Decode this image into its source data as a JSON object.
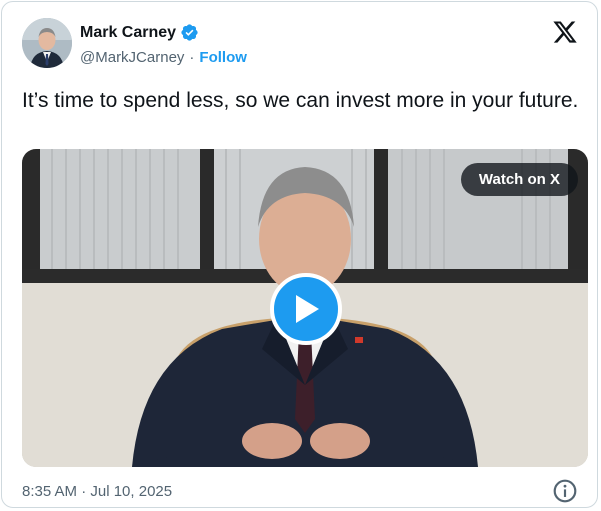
{
  "author": {
    "name": "Mark Carney",
    "handle": "@MarkJCarney",
    "separator": "·",
    "follow_label": "Follow"
  },
  "tweet": {
    "text": "It’s time to spend less, so we can invest more in your future."
  },
  "media": {
    "watch_label": "Watch on X"
  },
  "meta": {
    "timestamp": "8:35 AM · Jul 10, 2025"
  },
  "colors": {
    "accent": "#1d9bf0",
    "text": "#0f1419",
    "secondary": "#536471"
  },
  "icons": [
    "verified-badge-icon",
    "x-logo-icon",
    "play-icon",
    "info-icon"
  ]
}
